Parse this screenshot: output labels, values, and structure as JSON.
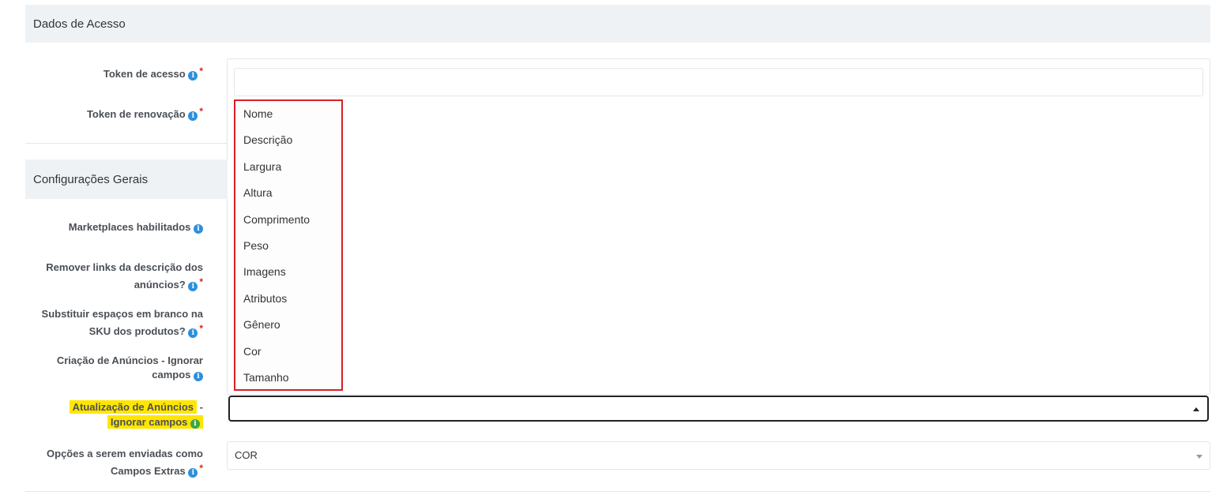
{
  "sections": {
    "acesso": "Dados de Acesso",
    "gerais": "Configurações Gerais"
  },
  "fields": {
    "token_acesso": "Token de acesso",
    "token_renovacao": "Token de renovação",
    "marketplaces": "Marketplaces habilitados",
    "remover_links_1": "Remover links da descrição dos",
    "remover_links_2": "anúncios?",
    "substituir_1": "Substituir espaços em branco na",
    "substituir_2": "SKU dos produtos?",
    "criacao_1": "Criação de Anúncios - Ignorar",
    "criacao_2": "campos",
    "atualizacao_1": "Atualização de Anúncios",
    "atualizacao_dash": "-",
    "atualizacao_2": "Ignorar campos",
    "opcoes_1": "Opções a serem enviadas como",
    "opcoes_2": "Campos Extras"
  },
  "dropdown_options": [
    "Nome",
    "Descrição",
    "Largura",
    "Altura",
    "Comprimento",
    "Peso",
    "Imagens",
    "Atributos",
    "Gênero",
    "Cor",
    "Tamanho"
  ],
  "opcoes_value": "COR",
  "icons": {
    "info": "i",
    "required": "*"
  },
  "colors": {
    "highlight": "#ffe600",
    "info": "#2d8fdd",
    "info_green": "#3aa845",
    "required": "#e02020",
    "selection_border": "#d92027"
  }
}
